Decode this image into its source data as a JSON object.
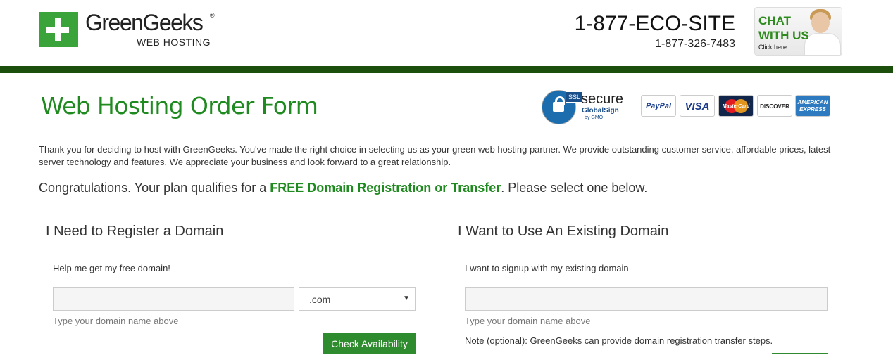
{
  "header": {
    "logo_name": "GreenGeeks",
    "logo_registered": "®",
    "logo_sub": "WEB HOSTING",
    "phone_primary": "1-877-ECO-SITE",
    "phone_secondary": "1-877-326-7483",
    "chat": {
      "line1": "CHAT",
      "line2": "WITH US",
      "line3": "Click here"
    }
  },
  "page": {
    "title": "Web Hosting Order Form",
    "intro": "Thank you for deciding to host with GreenGeeks. You've made the right choice in selecting us as your green web hosting partner. We provide outstanding customer service, affordable prices, latest server technology and features. We appreciate your business and look forward to a great relationship.",
    "congrats_prefix": "Congratulations. Your plan qualifies for a ",
    "congrats_highlight": "FREE Domain Registration or Transfer",
    "congrats_suffix": ". Please select one below."
  },
  "badges": {
    "ssl_tag": "SSL",
    "secure_title": "secure",
    "secure_sub": "GlobalSign",
    "secure_by": "by GMO",
    "cards": [
      "PayPal",
      "VISA",
      "MasterCard",
      "DISCOVER",
      "AMERICAN EXPRESS"
    ]
  },
  "register": {
    "heading": "I Need to Register a Domain",
    "desc": "Help me get my free domain!",
    "input_value": "",
    "tld_selected": ".com",
    "hint": "Type your domain name above",
    "button": "Check Availability"
  },
  "existing": {
    "heading": "I Want to Use An Existing Domain",
    "desc": "I want to signup with my existing domain",
    "input_value": "",
    "hint": "Type your domain name above",
    "note": "Note (optional): GreenGeeks can provide domain registration transfer steps."
  },
  "colors": {
    "brand_green": "#1f8a1f",
    "header_bar": "#1c4e0c",
    "button_green": "#2e8b2e"
  },
  "icons": [
    "plus-logo-icon",
    "ssl-lock-icon",
    "dropdown-arrow-icon"
  ]
}
